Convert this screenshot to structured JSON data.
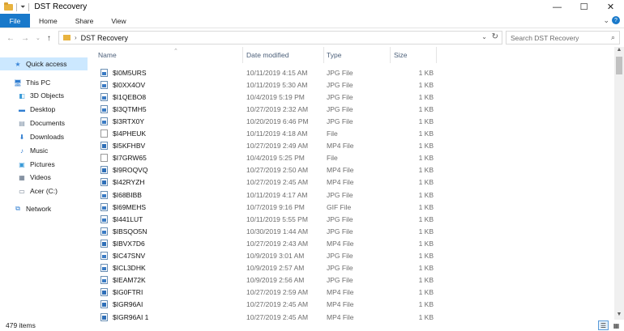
{
  "window": {
    "title": "DST Recovery",
    "minimize": "—",
    "maximize": "☐",
    "close": "✕"
  },
  "ribbon": {
    "tabs": [
      "File",
      "Home",
      "Share",
      "View"
    ],
    "expand": "⌄",
    "help": "?"
  },
  "address": {
    "path": "DST Recovery",
    "chevron": "›",
    "search_placeholder": "Search DST Recovery"
  },
  "sidebar": {
    "items": [
      {
        "label": "Quick access",
        "icon": "star-icon"
      },
      {
        "label": "This PC",
        "icon": "computer-icon"
      },
      {
        "label": "3D Objects",
        "icon": "cube-icon"
      },
      {
        "label": "Desktop",
        "icon": "desktop-icon"
      },
      {
        "label": "Documents",
        "icon": "documents-icon"
      },
      {
        "label": "Downloads",
        "icon": "download-icon"
      },
      {
        "label": "Music",
        "icon": "music-icon"
      },
      {
        "label": "Pictures",
        "icon": "pictures-icon"
      },
      {
        "label": "Videos",
        "icon": "videos-icon"
      },
      {
        "label": "Acer (C:)",
        "icon": "drive-icon"
      },
      {
        "label": "Network",
        "icon": "network-icon"
      }
    ]
  },
  "columns": {
    "name": "Name",
    "date": "Date modified",
    "type": "Type",
    "size": "Size"
  },
  "files": [
    {
      "name": "$I0M5URS",
      "date": "10/11/2019 4:15 AM",
      "type": "JPG File",
      "size": "1 KB",
      "icon": "jpg"
    },
    {
      "name": "$I0XX4OV",
      "date": "10/11/2019 5:30 AM",
      "type": "JPG File",
      "size": "1 KB",
      "icon": "jpg"
    },
    {
      "name": "$I1QEBO8",
      "date": "10/4/2019 5:19 PM",
      "type": "JPG File",
      "size": "1 KB",
      "icon": "jpg"
    },
    {
      "name": "$I3QTMH5",
      "date": "10/27/2019 2:32 AM",
      "type": "JPG File",
      "size": "1 KB",
      "icon": "jpg"
    },
    {
      "name": "$I3RTX0Y",
      "date": "10/20/2019 6:46 PM",
      "type": "JPG File",
      "size": "1 KB",
      "icon": "jpg"
    },
    {
      "name": "$I4PHEUK",
      "date": "10/11/2019 4:18 AM",
      "type": "File",
      "size": "1 KB",
      "icon": "blank"
    },
    {
      "name": "$I5KFHBV",
      "date": "10/27/2019 2:49 AM",
      "type": "MP4 File",
      "size": "1 KB",
      "icon": "media"
    },
    {
      "name": "$I7GRW65",
      "date": "10/4/2019 5:25 PM",
      "type": "File",
      "size": "1 KB",
      "icon": "blank"
    },
    {
      "name": "$I9ROQVQ",
      "date": "10/27/2019 2:50 AM",
      "type": "MP4 File",
      "size": "1 KB",
      "icon": "media"
    },
    {
      "name": "$I42RYZH",
      "date": "10/27/2019 2:45 AM",
      "type": "MP4 File",
      "size": "1 KB",
      "icon": "media"
    },
    {
      "name": "$I68BIBB",
      "date": "10/11/2019 4:17 AM",
      "type": "JPG File",
      "size": "1 KB",
      "icon": "jpg"
    },
    {
      "name": "$I69MEHS",
      "date": "10/7/2019 9:16 PM",
      "type": "GIF File",
      "size": "1 KB",
      "icon": "jpg"
    },
    {
      "name": "$I441LUT",
      "date": "10/11/2019 5:55 PM",
      "type": "JPG File",
      "size": "1 KB",
      "icon": "jpg"
    },
    {
      "name": "$IBSQO5N",
      "date": "10/30/2019 1:44 AM",
      "type": "JPG File",
      "size": "1 KB",
      "icon": "jpg"
    },
    {
      "name": "$IBVX7D6",
      "date": "10/27/2019 2:43 AM",
      "type": "MP4 File",
      "size": "1 KB",
      "icon": "media"
    },
    {
      "name": "$IC47SNV",
      "date": "10/9/2019 3:01 AM",
      "type": "JPG File",
      "size": "1 KB",
      "icon": "jpg"
    },
    {
      "name": "$ICL3DHK",
      "date": "10/9/2019 2:57 AM",
      "type": "JPG File",
      "size": "1 KB",
      "icon": "jpg"
    },
    {
      "name": "$IEAM72K",
      "date": "10/9/2019 2:56 AM",
      "type": "JPG File",
      "size": "1 KB",
      "icon": "jpg"
    },
    {
      "name": "$IG0FTRI",
      "date": "10/27/2019 2:59 AM",
      "type": "MP4 File",
      "size": "1 KB",
      "icon": "media"
    },
    {
      "name": "$IGR96AI",
      "date": "10/27/2019 2:45 AM",
      "type": "MP4 File",
      "size": "1 KB",
      "icon": "media"
    },
    {
      "name": "$IGR96AI 1",
      "date": "10/27/2019 2:45 AM",
      "type": "MP4 File",
      "size": "1 KB",
      "icon": "media"
    }
  ],
  "status": {
    "count": "479 items"
  }
}
